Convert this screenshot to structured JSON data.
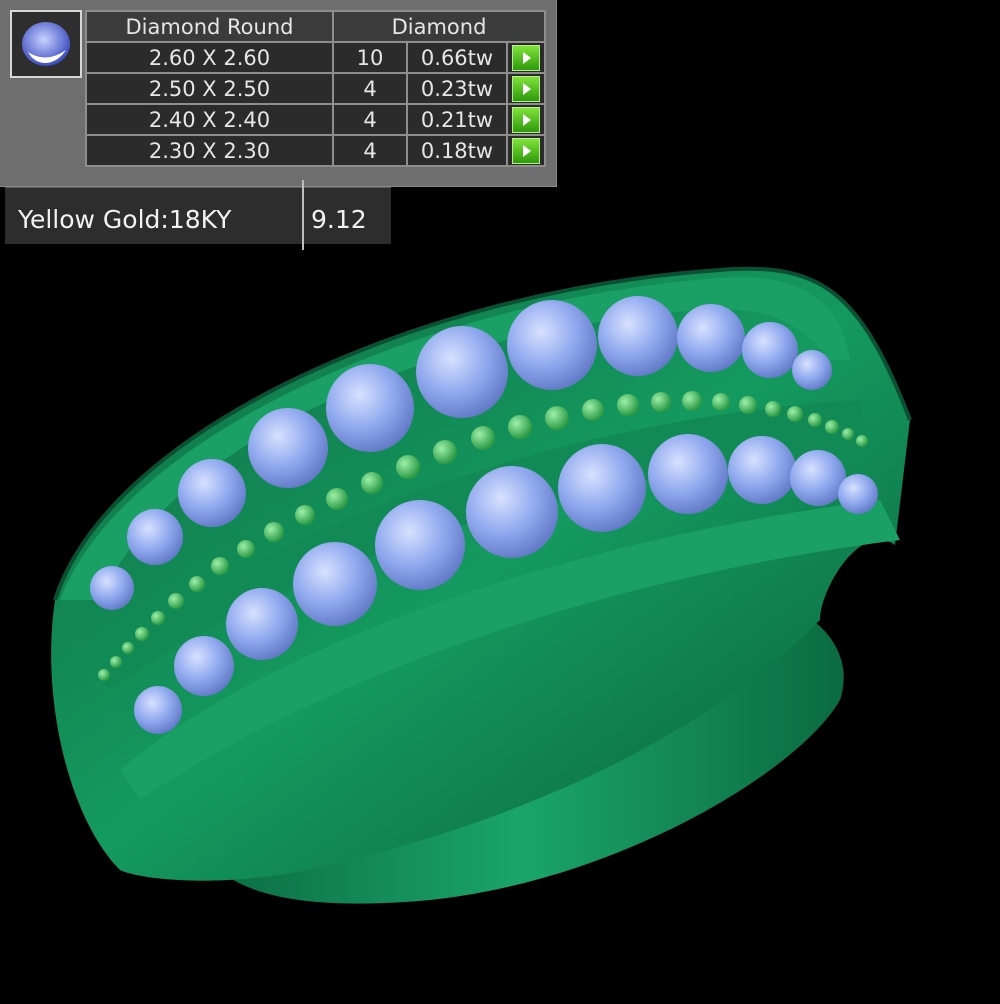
{
  "stone_table": {
    "headers": {
      "shape": "Diamond Round",
      "type": "Diamond"
    },
    "rows": [
      {
        "size": "2.60 X 2.60",
        "count": "10",
        "weight": "0.66tw"
      },
      {
        "size": "2.50 X 2.50",
        "count": "4",
        "weight": "0.23tw"
      },
      {
        "size": "2.40 X 2.40",
        "count": "4",
        "weight": "0.21tw"
      },
      {
        "size": "2.30 X 2.30",
        "count": "4",
        "weight": "0.18tw"
      }
    ]
  },
  "metal": {
    "name": "Yellow Gold:18KY",
    "weight": "9.12"
  },
  "colors": {
    "metal_render": "#118a55",
    "stone_render": "#8fa8ee",
    "bead_render": "#3fbf5a"
  },
  "icons": {
    "stone_thumbnail": "round-diamond-icon",
    "row_action": "play-arrow-icon"
  }
}
